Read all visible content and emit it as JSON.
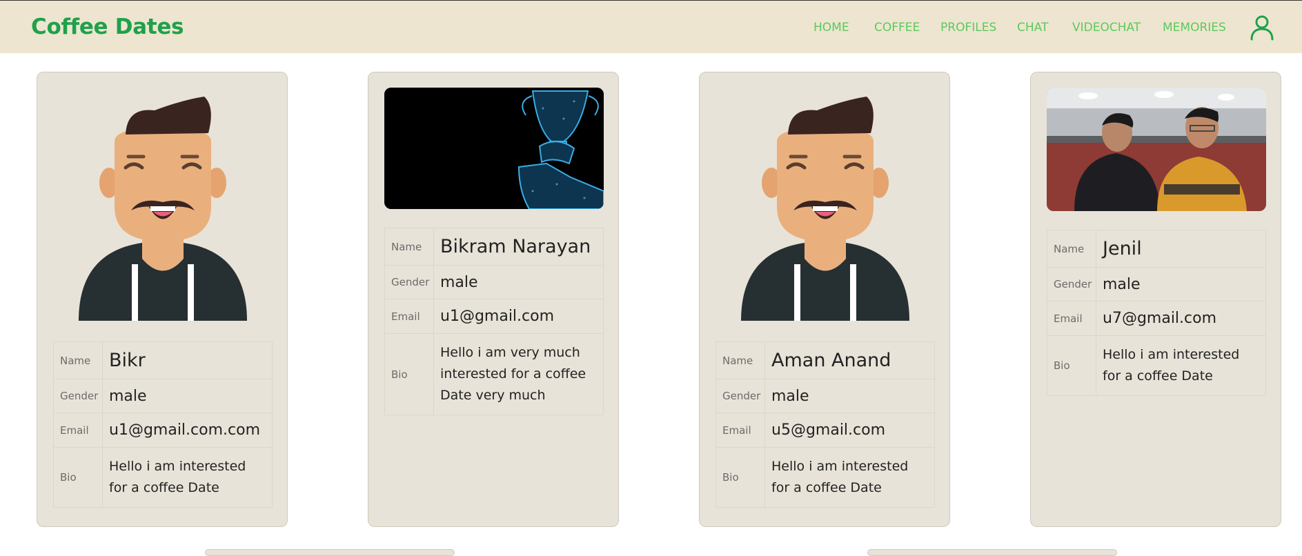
{
  "brand": "Coffee Dates",
  "nav": [
    "HOME",
    "COFFEE",
    "PROFILES",
    "CHAT",
    "VIDEOCHAT",
    "MEMORIES"
  ],
  "labels": {
    "name": "Name",
    "gender": "Gender",
    "email": "Email",
    "bio": "Bio"
  },
  "profiles": [
    {
      "name": "Bikr",
      "gender": "male",
      "email": "u1@gmail.com.com",
      "bio": "Hello i am interested for a coffee Date",
      "picture": "cartoon-avatar"
    },
    {
      "name": "Bikram Narayan",
      "gender": "male",
      "email": "u1@gmail.com",
      "bio": "Hello i am very much interested for a coffee Date very much",
      "picture": "trophy-photo"
    },
    {
      "name": "Aman Anand",
      "gender": "male",
      "email": "u5@gmail.com",
      "bio": "Hello i am interested for a coffee Date",
      "picture": "cartoon-avatar"
    },
    {
      "name": "Jenil",
      "gender": "male",
      "email": "u7@gmail.com",
      "bio": "Hello i am interested for a coffee Date",
      "picture": "group-photo"
    }
  ],
  "colors": {
    "brand": "#1fa14a",
    "nav_link": "#5cc95c",
    "navbar_bg": "#ede5d0",
    "card_bg": "#e8e3d8"
  },
  "icons": {
    "user": "user-profile-icon"
  }
}
